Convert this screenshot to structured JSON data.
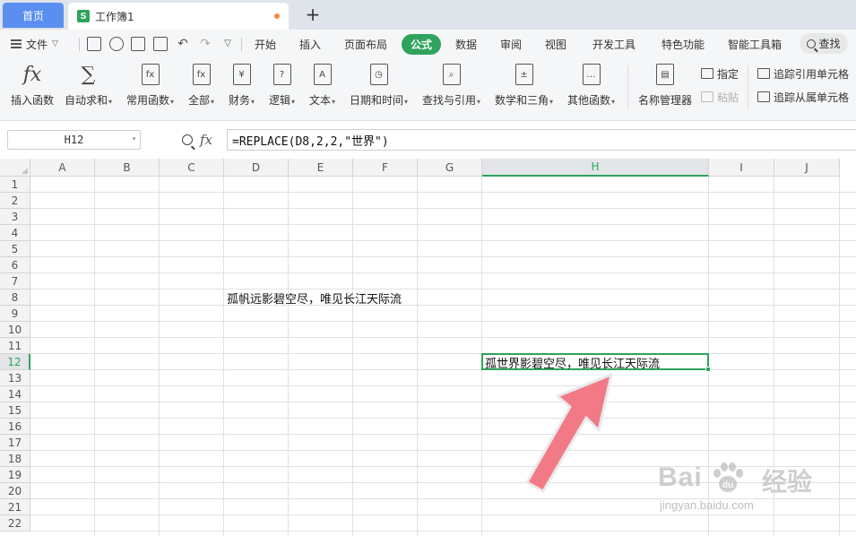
{
  "tabs": {
    "home": "首页",
    "doc_icon": "S",
    "doc_title": "工作簿1",
    "add": "+"
  },
  "menu": {
    "file": "文件",
    "items": [
      "开始",
      "插入",
      "页面布局",
      "公式",
      "数据",
      "审阅",
      "视图",
      "开发工具",
      "特色功能",
      "智能工具箱"
    ],
    "active": "公式",
    "search": "查找"
  },
  "ribbon": {
    "insert_function": "插入函数",
    "autosum": "自动求和",
    "common_functions": "常用函数",
    "all": "全部",
    "finance": "财务",
    "logic": "逻辑",
    "text": "文本",
    "datetime": "日期和时间",
    "lookup": "查找与引用",
    "math": "数学和三角",
    "other": "其他函数",
    "name_manager": "名称管理器",
    "define": "指定",
    "paste": "粘贴",
    "trace_precedents": "追踪引用单元格",
    "trace_dependents": "追踪从属单元格",
    "icon_texts": {
      "fx": "fx",
      "sigma": "∑",
      "finance": "¥",
      "logic": "?",
      "text": "A"
    }
  },
  "formula_bar": {
    "name_box": "H12",
    "formula": "=REPLACE(D8,2,2,\"世界\")",
    "fx_label": "fx"
  },
  "sheet": {
    "columns": [
      "A",
      "B",
      "C",
      "D",
      "E",
      "F",
      "G",
      "H",
      "I",
      "J"
    ],
    "rows": [
      "1",
      "2",
      "3",
      "4",
      "5",
      "6",
      "7",
      "8",
      "9",
      "10",
      "11",
      "12",
      "13",
      "14",
      "15",
      "16",
      "17",
      "18",
      "19",
      "20",
      "21",
      "22"
    ],
    "selected_column": "H",
    "selected_row": "12",
    "cells": {
      "D8": "孤帆远影碧空尽，唯见长江天际流",
      "H12": "孤世界影碧空尽，唯见长江天际流"
    }
  },
  "watermark": {
    "brand": "Bai",
    "brand_du": "du",
    "cn": "经验",
    "url": "jingyan.baidu.com"
  },
  "colors": {
    "accent_green": "#2fa35d",
    "home_tab_blue": "#5a8ff0",
    "arrow_pink": "#f27a86"
  }
}
